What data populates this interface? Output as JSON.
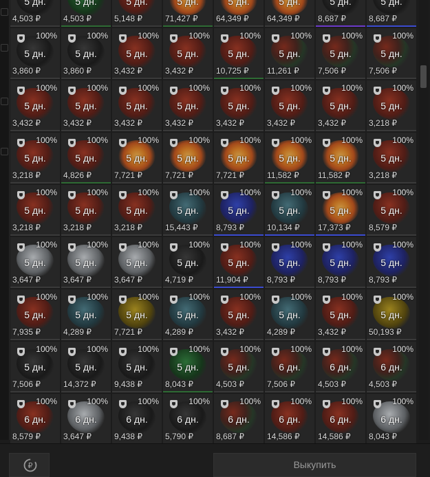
{
  "colors": {
    "background": "#1c1c1c",
    "cell": "#262626",
    "rarity_green": "#2e6b34",
    "rarity_blue": "#3b4bd0",
    "rarity_purple": "#6b3ac9"
  },
  "icons": {
    "cell_badge": "shield-icon",
    "refund": "ruble-refresh-icon"
  },
  "footer": {
    "refund_button_icon": "ruble-refresh-icon",
    "buyout_label": "Выкупить"
  },
  "items": [
    {
      "term": "5 дн.",
      "price": "4,503 ₽",
      "icon": "dark",
      "rarity": ""
    },
    {
      "term": "5 дн.",
      "price": "4,503 ₽",
      "icon": "green",
      "rarity": "green"
    },
    {
      "term": "5 дн.",
      "price": "5,148 ₽",
      "icon": "red",
      "rarity": ""
    },
    {
      "term": "5 дн.",
      "price": "71,427 ₽",
      "icon": "orange",
      "rarity": "green"
    },
    {
      "term": "5 дн.",
      "price": "64,349 ₽",
      "icon": "orange",
      "rarity": ""
    },
    {
      "term": "5 дн.",
      "price": "64,349 ₽",
      "icon": "orange",
      "rarity": ""
    },
    {
      "term": "5 дн.",
      "price": "8,687 ₽",
      "icon": "dark",
      "rarity": "purple"
    },
    {
      "term": "5 дн.",
      "price": "8,687 ₽",
      "icon": "dark",
      "rarity": "blue"
    },
    {
      "pct": "100%",
      "term": "5 дн.",
      "price": "3,860 ₽",
      "icon": "dark",
      "rarity": ""
    },
    {
      "pct": "100%",
      "term": "5 дн.",
      "price": "3,860 ₽",
      "icon": "dark",
      "rarity": ""
    },
    {
      "pct": "100%",
      "term": "5 дн.",
      "price": "3,432 ₽",
      "icon": "red",
      "rarity": ""
    },
    {
      "pct": "100%",
      "term": "5 дн.",
      "price": "3,432 ₽",
      "icon": "red",
      "rarity": ""
    },
    {
      "pct": "100%",
      "term": "5 дн.",
      "price": "10,725 ₽",
      "icon": "red",
      "rarity": "green"
    },
    {
      "pct": "100%",
      "term": "5 дн.",
      "price": "11,261 ₽",
      "icon": "mixed",
      "rarity": ""
    },
    {
      "pct": "100%",
      "term": "5 дн.",
      "price": "7,506 ₽",
      "icon": "mixed",
      "rarity": ""
    },
    {
      "pct": "100%",
      "term": "5 дн.",
      "price": "7,506 ₽",
      "icon": "mixed",
      "rarity": ""
    },
    {
      "pct": "100%",
      "term": "5 дн.",
      "price": "3,432 ₽",
      "icon": "red",
      "rarity": ""
    },
    {
      "pct": "100%",
      "term": "5 дн.",
      "price": "3,432 ₽",
      "icon": "red",
      "rarity": ""
    },
    {
      "pct": "100%",
      "term": "5 дн.",
      "price": "3,432 ₽",
      "icon": "red",
      "rarity": ""
    },
    {
      "pct": "100%",
      "term": "5 дн.",
      "price": "3,432 ₽",
      "icon": "red",
      "rarity": ""
    },
    {
      "pct": "100%",
      "term": "5 дн.",
      "price": "3,432 ₽",
      "icon": "red",
      "rarity": ""
    },
    {
      "pct": "100%",
      "term": "5 дн.",
      "price": "3,432 ₽",
      "icon": "red",
      "rarity": ""
    },
    {
      "pct": "100%",
      "term": "5 дн.",
      "price": "3,432 ₽",
      "icon": "red",
      "rarity": ""
    },
    {
      "pct": "100%",
      "term": "5 дн.",
      "price": "3,218 ₽",
      "icon": "red",
      "rarity": ""
    },
    {
      "pct": "100%",
      "term": "5 дн.",
      "price": "3,218 ₽",
      "icon": "red",
      "rarity": ""
    },
    {
      "pct": "100%",
      "term": "5 дн.",
      "price": "4,826 ₽",
      "icon": "red",
      "rarity": "green"
    },
    {
      "pct": "100%",
      "term": "5 дн.",
      "price": "7,721 ₽",
      "icon": "orange",
      "rarity": ""
    },
    {
      "pct": "100%",
      "term": "5 дн.",
      "price": "7,721 ₽",
      "icon": "orange",
      "rarity": ""
    },
    {
      "pct": "100%",
      "term": "5 дн.",
      "price": "7,721 ₽",
      "icon": "orange",
      "rarity": ""
    },
    {
      "pct": "100%",
      "term": "5 дн.",
      "price": "11,582 ₽",
      "icon": "orange",
      "rarity": "green"
    },
    {
      "pct": "100%",
      "term": "5 дн.",
      "price": "11,582 ₽",
      "icon": "orange",
      "rarity": "green"
    },
    {
      "pct": "100%",
      "term": "5 дн.",
      "price": "3,218 ₽",
      "icon": "red",
      "rarity": ""
    },
    {
      "pct": "100%",
      "term": "5 дн.",
      "price": "3,218 ₽",
      "icon": "red",
      "rarity": ""
    },
    {
      "pct": "100%",
      "term": "5 дн.",
      "price": "3,218 ₽",
      "icon": "red",
      "rarity": ""
    },
    {
      "pct": "100%",
      "term": "5 дн.",
      "price": "3,218 ₽",
      "icon": "red",
      "rarity": ""
    },
    {
      "pct": "100%",
      "term": "5 дн.",
      "price": "15,443 ₽",
      "icon": "teal",
      "rarity": ""
    },
    {
      "pct": "100%",
      "term": "5 дн.",
      "price": "8,793 ₽",
      "icon": "blue",
      "rarity": "blue"
    },
    {
      "pct": "100%",
      "term": "5 дн.",
      "price": "10,134 ₽",
      "icon": "teal",
      "rarity": "blue"
    },
    {
      "pct": "100%",
      "term": "5 дн.",
      "price": "17,373 ₽",
      "icon": "orange",
      "rarity": "blue"
    },
    {
      "pct": "100%",
      "term": "5 дн.",
      "price": "8,579 ₽",
      "icon": "red",
      "rarity": ""
    },
    {
      "pct": "100%",
      "term": "5 дн.",
      "price": "3,647 ₽",
      "icon": "white",
      "rarity": ""
    },
    {
      "pct": "100%",
      "term": "5 дн.",
      "price": "3,647 ₽",
      "icon": "white",
      "rarity": ""
    },
    {
      "pct": "100%",
      "term": "5 дн.",
      "price": "3,647 ₽",
      "icon": "white",
      "rarity": ""
    },
    {
      "pct": "100%",
      "term": "5 дн.",
      "price": "4,719 ₽",
      "icon": "dark",
      "rarity": ""
    },
    {
      "pct": "100%",
      "term": "5 дн.",
      "price": "11,904 ₽",
      "icon": "red",
      "rarity": "blue"
    },
    {
      "pct": "100%",
      "term": "5 дн.",
      "price": "8,793 ₽",
      "icon": "blue",
      "rarity": ""
    },
    {
      "pct": "100%",
      "term": "5 дн.",
      "price": "8,793 ₽",
      "icon": "blue",
      "rarity": ""
    },
    {
      "pct": "100%",
      "term": "5 дн.",
      "price": "8,793 ₽",
      "icon": "blue",
      "rarity": ""
    },
    {
      "pct": "100%",
      "term": "5 дн.",
      "price": "7,935 ₽",
      "icon": "red",
      "rarity": ""
    },
    {
      "pct": "100%",
      "term": "5 дн.",
      "price": "4,289 ₽",
      "icon": "teal",
      "rarity": ""
    },
    {
      "pct": "100%",
      "term": "5 дн.",
      "price": "7,721 ₽",
      "icon": "yellow",
      "rarity": ""
    },
    {
      "pct": "100%",
      "term": "5 дн.",
      "price": "4,289 ₽",
      "icon": "teal",
      "rarity": ""
    },
    {
      "pct": "100%",
      "term": "5 дн.",
      "price": "3,432 ₽",
      "icon": "red",
      "rarity": ""
    },
    {
      "pct": "100%",
      "term": "5 дн.",
      "price": "4,289 ₽",
      "icon": "teal",
      "rarity": ""
    },
    {
      "pct": "100%",
      "term": "5 дн.",
      "price": "3,432 ₽",
      "icon": "red",
      "rarity": ""
    },
    {
      "pct": "100%",
      "term": "5 дн.",
      "price": "50,193 ₽",
      "icon": "yellow",
      "rarity": ""
    },
    {
      "pct": "100%",
      "term": "5 дн.",
      "price": "7,506 ₽",
      "icon": "dark",
      "rarity": ""
    },
    {
      "pct": "100%",
      "term": "5 дн.",
      "price": "14,372 ₽",
      "icon": "dark",
      "rarity": ""
    },
    {
      "pct": "100%",
      "term": "5 дн.",
      "price": "9,438 ₽",
      "icon": "dark",
      "rarity": ""
    },
    {
      "pct": "100%",
      "term": "5 дн.",
      "price": "8,043 ₽",
      "icon": "green",
      "rarity": "green"
    },
    {
      "pct": "100%",
      "term": "5 дн.",
      "price": "4,503 ₽",
      "icon": "mixed",
      "rarity": ""
    },
    {
      "pct": "100%",
      "term": "6 дн.",
      "price": "7,506 ₽",
      "icon": "mixed",
      "rarity": ""
    },
    {
      "pct": "100%",
      "term": "6 дн.",
      "price": "4,503 ₽",
      "icon": "mixed",
      "rarity": ""
    },
    {
      "pct": "100%",
      "term": "6 дн.",
      "price": "4,503 ₽",
      "icon": "mixed",
      "rarity": ""
    },
    {
      "pct": "100%",
      "term": "6 дн.",
      "price": "8,579 ₽",
      "icon": "red",
      "rarity": ""
    },
    {
      "pct": "100%",
      "term": "6 дн.",
      "price": "3,647 ₽",
      "icon": "white",
      "rarity": ""
    },
    {
      "pct": "100%",
      "term": "6 дн.",
      "price": "9,438 ₽",
      "icon": "dark",
      "rarity": ""
    },
    {
      "pct": "100%",
      "term": "6 дн.",
      "price": "5,790 ₽",
      "icon": "dark",
      "rarity": "green"
    },
    {
      "pct": "100%",
      "term": "6 дн.",
      "price": "8,687 ₽",
      "icon": "mixed",
      "rarity": "purple"
    },
    {
      "pct": "100%",
      "term": "6 дн.",
      "price": "14,586 ₽",
      "icon": "red",
      "rarity": ""
    },
    {
      "pct": "100%",
      "term": "6 дн.",
      "price": "14,586 ₽",
      "icon": "red",
      "rarity": ""
    },
    {
      "pct": "100%",
      "term": "6 дн.",
      "price": "8,043 ₽",
      "icon": "white",
      "rarity": ""
    }
  ]
}
